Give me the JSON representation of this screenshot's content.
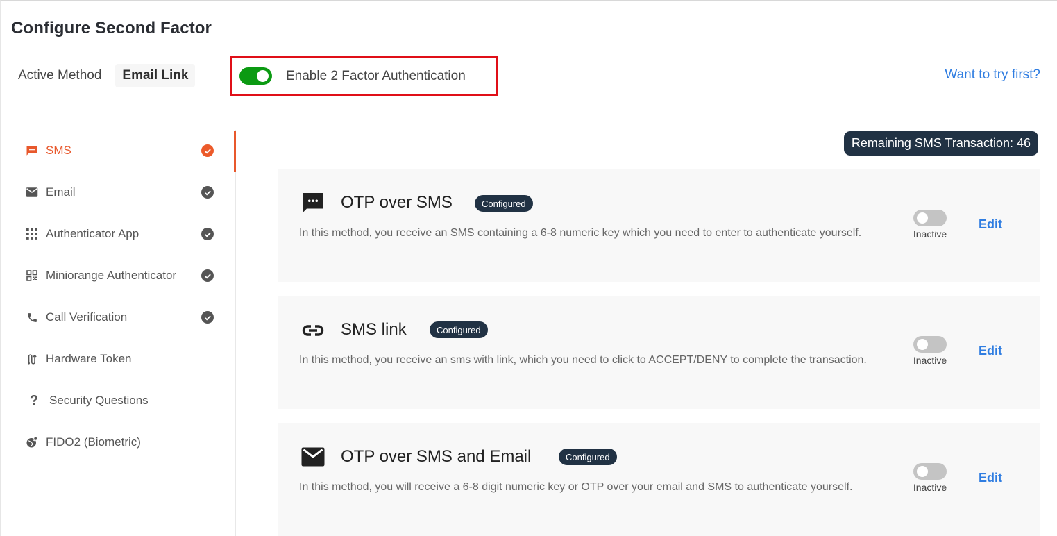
{
  "header": {
    "title": "Configure Second Factor",
    "active_method_label": "Active Method",
    "active_method_value": "Email Link",
    "enable_2fa_label": "Enable 2 Factor Authentication",
    "enable_2fa_enabled": true,
    "try_first_link": "Want to try first?"
  },
  "colors": {
    "accent": "#e8582c",
    "toggle_on": "#0b9a12",
    "link": "#2f7de1",
    "badge_bg": "#213244",
    "highlight_border": "#e00f18"
  },
  "sidebar": {
    "items": [
      {
        "label": "SMS",
        "icon": "sms-icon",
        "configured": true,
        "active": true
      },
      {
        "label": "Email",
        "icon": "email-icon",
        "configured": true,
        "active": false
      },
      {
        "label": "Authenticator App",
        "icon": "grid-icon",
        "configured": true,
        "active": false
      },
      {
        "label": "Miniorange Authenticator",
        "icon": "qr-code-icon",
        "configured": true,
        "active": false
      },
      {
        "label": "Call Verification",
        "icon": "phone-icon",
        "configured": true,
        "active": false
      },
      {
        "label": "Hardware Token",
        "icon": "hardware-token-icon",
        "configured": false,
        "active": false
      },
      {
        "label": "Security Questions",
        "icon": "question-icon",
        "configured": false,
        "active": false
      },
      {
        "label": "FIDO2 (Biometric)",
        "icon": "globe-fingerprint-icon",
        "configured": false,
        "active": false
      }
    ]
  },
  "main": {
    "remaining_sms": "Remaining SMS Transaction: 46",
    "methods": [
      {
        "title": "OTP over SMS",
        "icon": "sms-icon",
        "badge": "Configured",
        "description": "In this method, you receive an SMS containing a 6-8 numeric key which you need to enter to authenticate yourself.",
        "status": "Inactive",
        "active": false,
        "edit_label": "Edit"
      },
      {
        "title": "SMS link",
        "icon": "link-icon",
        "badge": "Configured",
        "description": "In this method, you receive an sms with link, which you need to click to ACCEPT/DENY to complete the transaction.",
        "status": "Inactive",
        "active": false,
        "edit_label": "Edit"
      },
      {
        "title": "OTP over SMS and Email",
        "icon": "email-icon",
        "badge": "Configured",
        "description": "In this method, you will receive a 6-8 digit numeric key or OTP over your email and SMS to authenticate yourself.",
        "status": "Inactive",
        "active": false,
        "edit_label": "Edit"
      }
    ]
  }
}
